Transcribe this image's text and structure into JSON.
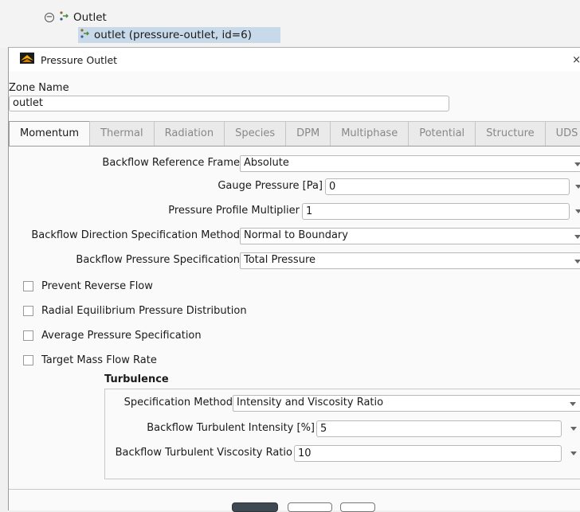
{
  "tree": {
    "outlet_label": "Outlet",
    "child_label": "outlet (pressure-outlet, id=6)"
  },
  "dialog": {
    "title": "Pressure Outlet",
    "close_glyph": "×",
    "zone_name_label": "Zone Name",
    "zone_name_value": "outlet"
  },
  "tabs": [
    {
      "label": "Momentum",
      "active": true
    },
    {
      "label": "Thermal"
    },
    {
      "label": "Radiation"
    },
    {
      "label": "Species"
    },
    {
      "label": "DPM"
    },
    {
      "label": "Multiphase"
    },
    {
      "label": "Potential"
    },
    {
      "label": "Structure"
    },
    {
      "label": "UDS"
    }
  ],
  "momentum": {
    "backflow_ref_frame": {
      "label": "Backflow Reference Frame",
      "value": "Absolute"
    },
    "gauge_pressure": {
      "label": "Gauge Pressure [Pa]",
      "value": "0"
    },
    "pressure_profile_multiplier": {
      "label": "Pressure Profile Multiplier",
      "value": "1"
    },
    "backflow_direction_method": {
      "label": "Backflow Direction Specification Method",
      "value": "Normal to Boundary"
    },
    "backflow_pressure_spec": {
      "label": "Backflow Pressure Specification",
      "value": "Total Pressure"
    },
    "checkboxes": [
      {
        "label": "Prevent Reverse Flow",
        "checked": false
      },
      {
        "label": "Radial Equilibrium Pressure Distribution",
        "checked": false
      },
      {
        "label": "Average Pressure Specification",
        "checked": false
      },
      {
        "label": "Target Mass Flow Rate",
        "checked": false
      }
    ]
  },
  "turbulence": {
    "heading": "Turbulence",
    "spec_method": {
      "label": "Specification Method",
      "value": "Intensity and Viscosity Ratio"
    },
    "intensity": {
      "label": "Backflow Turbulent Intensity [%]",
      "value": "5"
    },
    "viscosity_ratio": {
      "label": "Backflow Turbulent Viscosity Ratio",
      "value": "10"
    }
  },
  "icons": {
    "tree_collapse": "collapse-icon",
    "zone": "zone-icon",
    "app_logo": "fluent-logo-icon",
    "dropdown": "chevron-down-icon"
  }
}
